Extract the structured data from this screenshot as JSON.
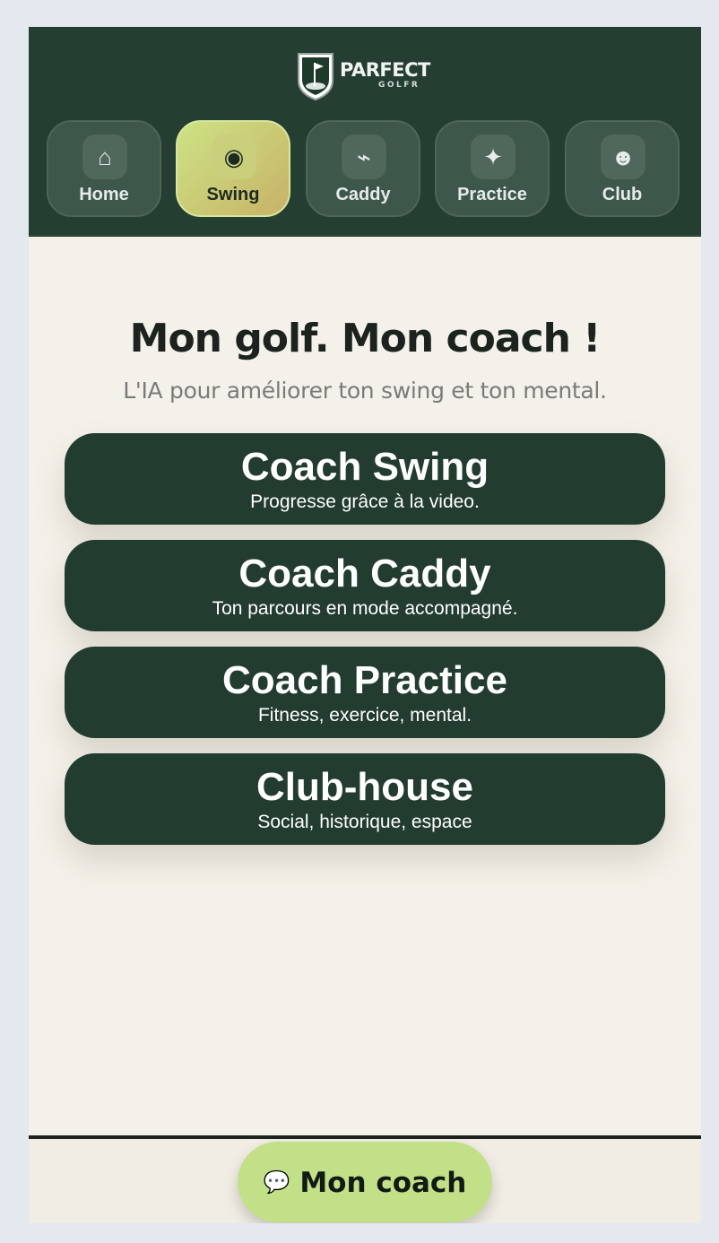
{
  "brand": {
    "name": "PARFECT",
    "sub": "GOLFR"
  },
  "nav": {
    "items": [
      {
        "label": "Home",
        "icon": "house-icon",
        "glyph": "⌂",
        "active": false
      },
      {
        "label": "Swing",
        "icon": "target-icon",
        "glyph": "◉",
        "active": true
      },
      {
        "label": "Caddy",
        "icon": "caddy-icon",
        "glyph": "⌁",
        "active": false
      },
      {
        "label": "Practice",
        "icon": "sparkle-icon",
        "glyph": "✦",
        "active": false
      },
      {
        "label": "Club",
        "icon": "smiley-icon",
        "glyph": "☻",
        "active": false
      }
    ]
  },
  "hero": {
    "title": "Mon golf. Mon coach !",
    "subtitle": "L'IA pour améliorer ton swing et ton mental."
  },
  "cards": [
    {
      "title": "Coach Swing",
      "subtitle": "Progresse grâce à la video."
    },
    {
      "title": "Coach Caddy",
      "subtitle": "Ton parcours en mode accompagné."
    },
    {
      "title": "Coach Practice",
      "subtitle": "Fitness, exercice, mental."
    },
    {
      "title": "Club-house",
      "subtitle": "Social, historique, espace"
    }
  ],
  "footer": {
    "coach_button_label": "Mon coach",
    "coach_button_icon": "speech-bubble-icon"
  },
  "colors": {
    "header_bg": "#243f31",
    "card_bg": "#223c2f",
    "accent": "#c2e087",
    "page_bg": "#f4f1ea"
  }
}
